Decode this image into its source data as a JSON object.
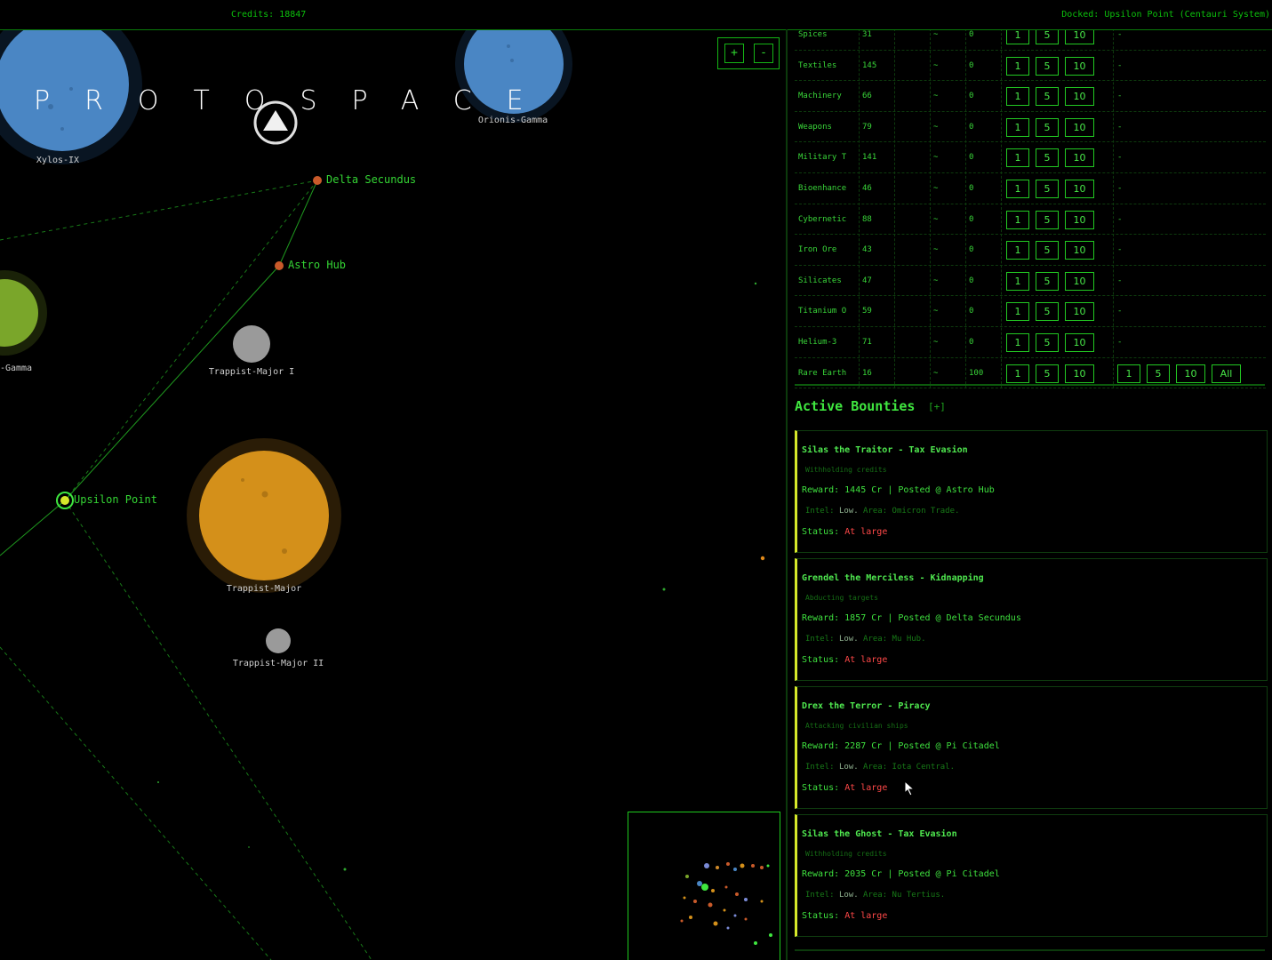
{
  "topbar": {
    "credits": "Credits: 18847",
    "docked": "Docked: Upsilon Point (Centauri System)"
  },
  "map": {
    "title": "PROTOSPACE",
    "zoom_in_label": "+",
    "zoom_out_label": "-",
    "planets": {
      "xylos": "Xylos-IX",
      "orionis": "Orionis-Gamma",
      "partial_gamma": "-Gamma",
      "trappist_major_i": "Trappist-Major I",
      "trappist_major": "Trappist-Major",
      "trappist_major_ii": "Trappist-Major II"
    },
    "stations": {
      "delta": "Delta Secundus",
      "astro": "Astro Hub",
      "upsilon": "Upsilon Point"
    }
  },
  "market": {
    "rows": [
      {
        "name": "Spices",
        "price": "31",
        "tilde": "~",
        "qty": "0",
        "buy": [
          "1",
          "5",
          "10"
        ],
        "sell": "-"
      },
      {
        "name": "Textiles",
        "price": "145",
        "tilde": "~",
        "qty": "0",
        "buy": [
          "1",
          "5",
          "10"
        ],
        "sell": "-"
      },
      {
        "name": "Machinery",
        "price": "66",
        "tilde": "~",
        "qty": "0",
        "buy": [
          "1",
          "5",
          "10"
        ],
        "sell": "-"
      },
      {
        "name": "Weapons",
        "price": "79",
        "tilde": "~",
        "qty": "0",
        "buy": [
          "1",
          "5",
          "10"
        ],
        "sell": "-"
      },
      {
        "name": "Military T",
        "price": "141",
        "tilde": "~",
        "qty": "0",
        "buy": [
          "1",
          "5",
          "10"
        ],
        "sell": "-"
      },
      {
        "name": "Bioenhance",
        "price": "46",
        "tilde": "~",
        "qty": "0",
        "buy": [
          "1",
          "5",
          "10"
        ],
        "sell": "-"
      },
      {
        "name": "Cybernetic",
        "price": "88",
        "tilde": "~",
        "qty": "0",
        "buy": [
          "1",
          "5",
          "10"
        ],
        "sell": "-"
      },
      {
        "name": "Iron Ore",
        "price": "43",
        "tilde": "~",
        "qty": "0",
        "buy": [
          "1",
          "5",
          "10"
        ],
        "sell": "-"
      },
      {
        "name": "Silicates",
        "price": "47",
        "tilde": "~",
        "qty": "0",
        "buy": [
          "1",
          "5",
          "10"
        ],
        "sell": "-"
      },
      {
        "name": "Titanium O",
        "price": "59",
        "tilde": "~",
        "qty": "0",
        "buy": [
          "1",
          "5",
          "10"
        ],
        "sell": "-"
      },
      {
        "name": "Helium-3",
        "price": "71",
        "tilde": "~",
        "qty": "0",
        "buy": [
          "1",
          "5",
          "10"
        ],
        "sell": "-"
      },
      {
        "name": "Rare Earth",
        "price": "16",
        "tilde": "~",
        "qty": "100",
        "buy": [
          "1",
          "5",
          "10"
        ],
        "sell_buttons": [
          "1",
          "5",
          "10",
          "All"
        ]
      }
    ]
  },
  "bounties": {
    "heading": "Active Bounties",
    "add_label": "[+]",
    "intel_prefix": "Intel:",
    "status_prefix": "Status:",
    "items": [
      {
        "title": "Silas the Traitor - Tax Evasion",
        "desc": "Withholding credits",
        "reward": "Reward: 1445 Cr | Posted @ Astro Hub",
        "intel_level": "Low.",
        "area": "Area: Omicron Trade.",
        "status": "At large"
      },
      {
        "title": "Grendel the Merciless - Kidnapping",
        "desc": "Abducting targets",
        "reward": "Reward: 1857 Cr | Posted @ Delta Secundus",
        "intel_level": "Low.",
        "area": "Area: Mu Hub.",
        "status": "At large"
      },
      {
        "title": "Drex the Terror - Piracy",
        "desc": "Attacking civilian ships",
        "reward": "Reward: 2287 Cr | Posted @ Pi Citadel",
        "intel_level": "Low.",
        "area": "Area: Iota Central.",
        "status": "At large"
      },
      {
        "title": "Silas the Ghost - Tax Evasion",
        "desc": "Withholding credits",
        "reward": "Reward: 2035 Cr | Posted @ Pi Citadel",
        "intel_level": "Low.",
        "area": "Area: Nu Tertius.",
        "status": "At large"
      }
    ]
  },
  "colors": {
    "accent": "#00e000",
    "bounty_border": "#d6e82a",
    "status_red": "#ff4848",
    "planet_blue": "#4a86c4",
    "planet_gold": "#d4901a",
    "planet_green": "#7aa62a"
  }
}
